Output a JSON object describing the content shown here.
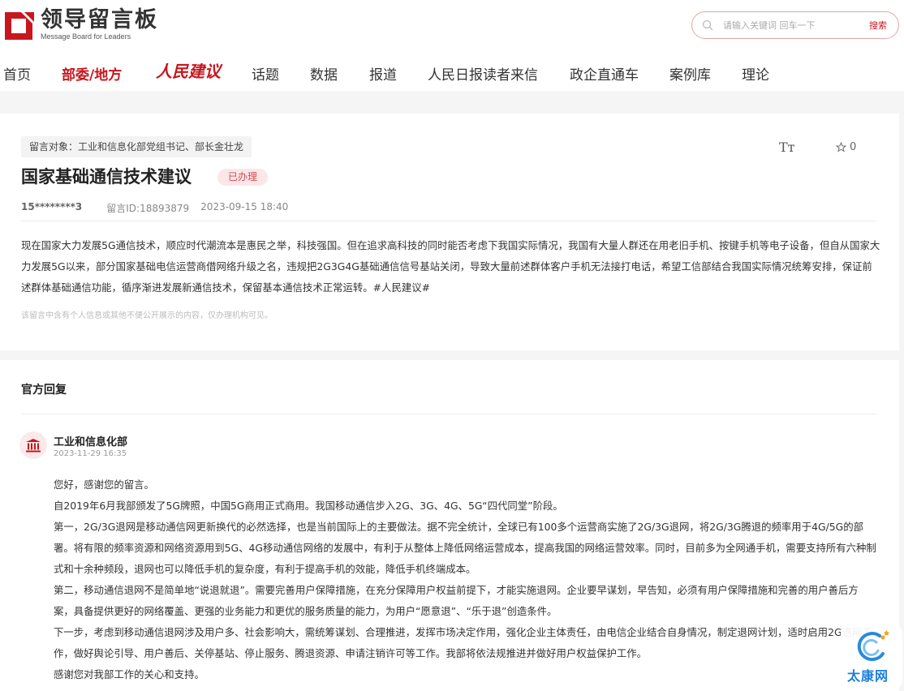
{
  "brand": {
    "name_cn": "领导留言板",
    "name_en": "Message Board for Leaders",
    "accent": "#c8161d"
  },
  "search": {
    "placeholder": "请输入关键词 回车一下",
    "button": "搜索"
  },
  "nav": [
    {
      "label": "首页",
      "active": false
    },
    {
      "label": "部委/地方",
      "active": true
    },
    {
      "label": "人民建议",
      "active": false
    },
    {
      "label": "话题",
      "active": false
    },
    {
      "label": "数据",
      "active": false
    },
    {
      "label": "报道",
      "active": false
    },
    {
      "label": "人民日报读者来信",
      "active": false
    },
    {
      "label": "政企直通车",
      "active": false
    },
    {
      "label": "案例库",
      "active": false
    },
    {
      "label": "理论",
      "active": false
    }
  ],
  "message": {
    "target": "留言对象：工业和信息化部党组书记、部长金壮龙",
    "font_toggle": "Tт",
    "favorites": "0",
    "title": "国家基础通信技术建议",
    "status": "已办理",
    "user": "15********3",
    "id_label": "留言ID:18893879",
    "datetime": "2023-09-15 18:40",
    "content": "现在国家大力发展5G通信技术，顺应时代潮流本是惠民之举，科技强国。但在追求高科技的同时能否考虑下我国实际情况，我国有大量人群还在用老旧手机、按键手机等电子设备，但自从国家大力发展5G以来，部分国家基础电信运营商借网络升级之名，违规把2G3G4G基础通信信号基站关闭，导致大量前述群体客户手机无法接打电话，希望工信部结合我国实际情况统筹安排，保证前述群体基础通信功能，循序渐进发展新通信技术，保留基本通信技术正常运转。#人民建议#",
    "notice": "该留言中含有个人信息或其他不便公开展示的内容，仅办理机构可见。"
  },
  "reply": {
    "section_title": "官方回复",
    "department": "工业和信息化部",
    "date": "2023-11-29 16:35",
    "paragraphs": [
      "您好，感谢您的留言。",
      "自2019年6月我部颁发了5G牌照，中国5G商用正式商用。我国移动通信步入2G、3G、4G、5G“四代同堂”阶段。",
      "第一，2G/3G退网是移动通信网更新换代的必然选择，也是当前国际上的主要做法。据不完全统计，全球已有100多个运营商实施了2G/3G退网，将2G/3G腾退的频率用于4G/5G的部署。将有限的频率资源和网络资源用到5G、4G移动通信网络的发展中，有利于从整体上降低网络运营成本，提高我国的网络运营效率。同时，目前多为全网通手机，需要支持所有六种制式和十余种频段，退网也可以降低手机的复杂度，有利于提高手机的效能，降低手机终端成本。",
      "第二，移动通信退网不是简单地“说退就退”。需要完善用户保障措施，在充分保障用户权益前提下，才能实施退网。企业要早谋划，早告知，必须有用户保障措施和完善的用户善后方案，具备提供更好的网络覆盖、更强的业务能力和更优的服务质量的能力，为用户“愿意退”、“乐于退”创造条件。",
      "下一步，考虑到移动通信退网涉及用户多、社会影响大，需统筹谋划、合理推进，发挥市场决定作用，强化企业主体责任，由电信企业结合自身情况，制定退网计划，适时启用2G退网工作，做好舆论引导、用户善后、关停基站、停止服务、腾退资源、申请注销许可等工作。我部将依法规推进并做好用户权益保护工作。",
      "感谢您对我部工作的关心和支持。"
    ]
  },
  "watermark": "太康网"
}
